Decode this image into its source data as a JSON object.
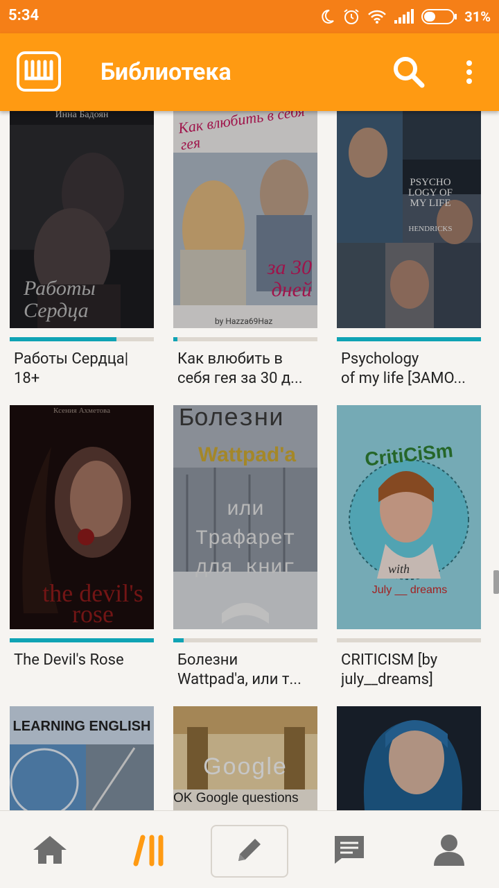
{
  "status": {
    "time": "5:34",
    "battery": "31%",
    "icons": [
      "moon-icon",
      "alarm-icon",
      "wifi-icon",
      "signal-icon",
      "battery-icon"
    ]
  },
  "app_bar": {
    "title": "Библиотека",
    "logo": "wattpad-logo",
    "search": "search-icon",
    "menu": "more-vertical-icon"
  },
  "colors": {
    "accent": "#ff9a12",
    "status": "#f57f17",
    "progress": "#0fa3b4",
    "nav_active": "#ff9a12",
    "nav_inactive": "#6e6e6e"
  },
  "books": [
    {
      "line1": "Работы Сердца|",
      "line2": "18+",
      "progress": 0.74,
      "cover_top": "Инна Бадоян",
      "cover_title": "Работы Сердца"
    },
    {
      "line1": "Как влюбить в",
      "line2": "себя гея за 30 д...",
      "progress": 0.03,
      "cover_top": "Как влюбить в себя гея",
      "cover_title": "за 30 дней",
      "cover_sub": "by Hazza69Haz"
    },
    {
      "line1": "Psychology",
      "line2": "of my life [ЗАМО...",
      "progress": 1.0,
      "cover_top": "PSYCHO LOGY OF MY LIFE",
      "cover_title": "HENDRICKS"
    },
    {
      "line1": "The Devil's Rose",
      "line2": "",
      "progress": 1.0,
      "cover_top": "Ксения Ахметова",
      "cover_title": "the devil's rose"
    },
    {
      "line1": "Болезни",
      "line2": "Wattpad'a, или т...",
      "progress": 0.07,
      "cover_top": "Болезни",
      "cover_title": "Wattpad'a",
      "cover_sub": "или Трафарет для книг"
    },
    {
      "line1": "CRITICISM [by",
      "line2": "july__dreams]",
      "progress": 0.0,
      "cover_top": "CritiCiSm",
      "cover_title": "with",
      "cover_sub": "July __ dreams"
    },
    {
      "line1": "",
      "line2": "",
      "progress": 0.0,
      "cover_top": "LEARNING ENGLISH",
      "cover_title": ""
    },
    {
      "line1": "",
      "line2": "",
      "progress": 0.0,
      "cover_top": "Google",
      "cover_title": "OK Google questions"
    },
    {
      "line1": "",
      "line2": "",
      "progress": 0.0,
      "cover_top": "",
      "cover_title": ""
    }
  ],
  "nav": {
    "items": [
      "home-icon",
      "library-icon",
      "write-icon",
      "messages-icon",
      "profile-icon"
    ],
    "active": "library-icon"
  }
}
